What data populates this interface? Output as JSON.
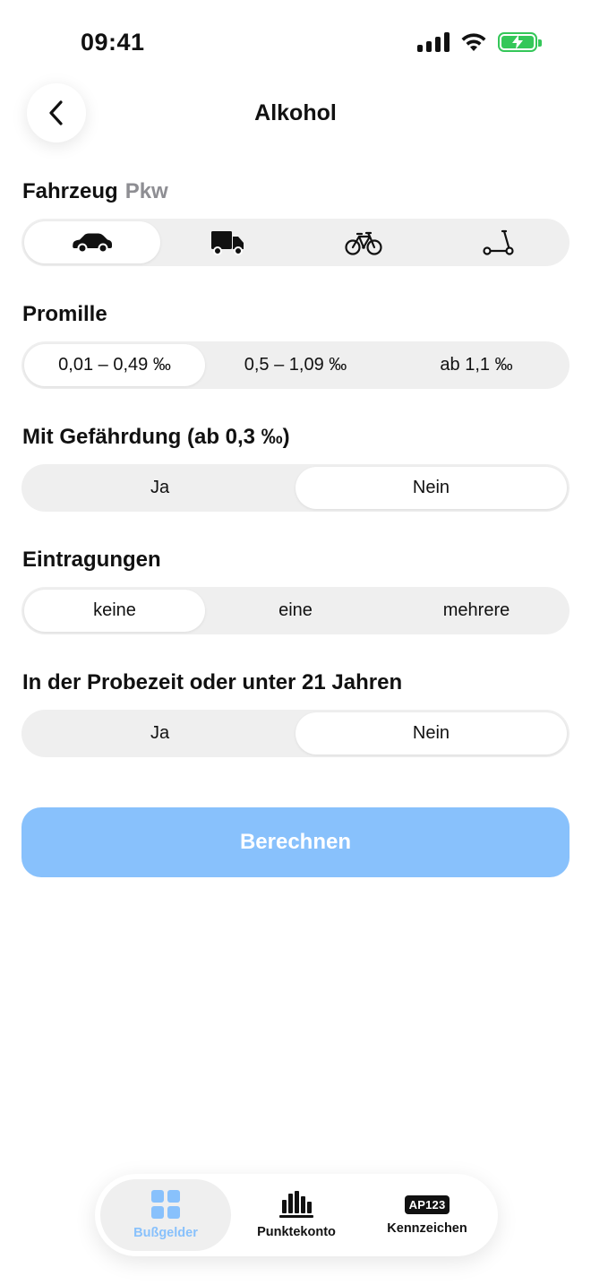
{
  "status": {
    "time": "09:41"
  },
  "header": {
    "title": "Alkohol"
  },
  "vehicle": {
    "label": "Fahrzeug",
    "selected_name": "Pkw",
    "options": [
      {
        "icon": "car-icon",
        "active": true
      },
      {
        "icon": "truck-icon",
        "active": false
      },
      {
        "icon": "bicycle-icon",
        "active": false
      },
      {
        "icon": "scooter-icon",
        "active": false
      }
    ]
  },
  "promille": {
    "label": "Promille",
    "options": [
      "0,01 – 0,49 ‰",
      "0,5 – 1,09 ‰",
      "ab 1,1 ‰"
    ],
    "selected": 0
  },
  "gefaehrdung": {
    "label": "Mit Gefährdung (ab 0,3 ‰)",
    "options": [
      "Ja",
      "Nein"
    ],
    "selected": 1
  },
  "eintragungen": {
    "label": "Eintragungen",
    "options": [
      "keine",
      "eine",
      "mehrere"
    ],
    "selected": 0
  },
  "probezeit": {
    "label": "In der Probezeit oder unter 21 Jahren",
    "options": [
      "Ja",
      "Nein"
    ],
    "selected": 1
  },
  "calculate_button": {
    "label": "Berechnen"
  },
  "tabs": [
    {
      "label": "Bußgelder",
      "icon": "grid-icon",
      "active": true
    },
    {
      "label": "Punktekonto",
      "icon": "bar-chart-icon",
      "active": false
    },
    {
      "label": "Kennzeichen",
      "icon": "license-plate-icon",
      "badge": "AP123",
      "active": false
    }
  ],
  "colors": {
    "accent": "#88c1fc",
    "battery": "#34c759",
    "segment_bg": "#efefef"
  }
}
